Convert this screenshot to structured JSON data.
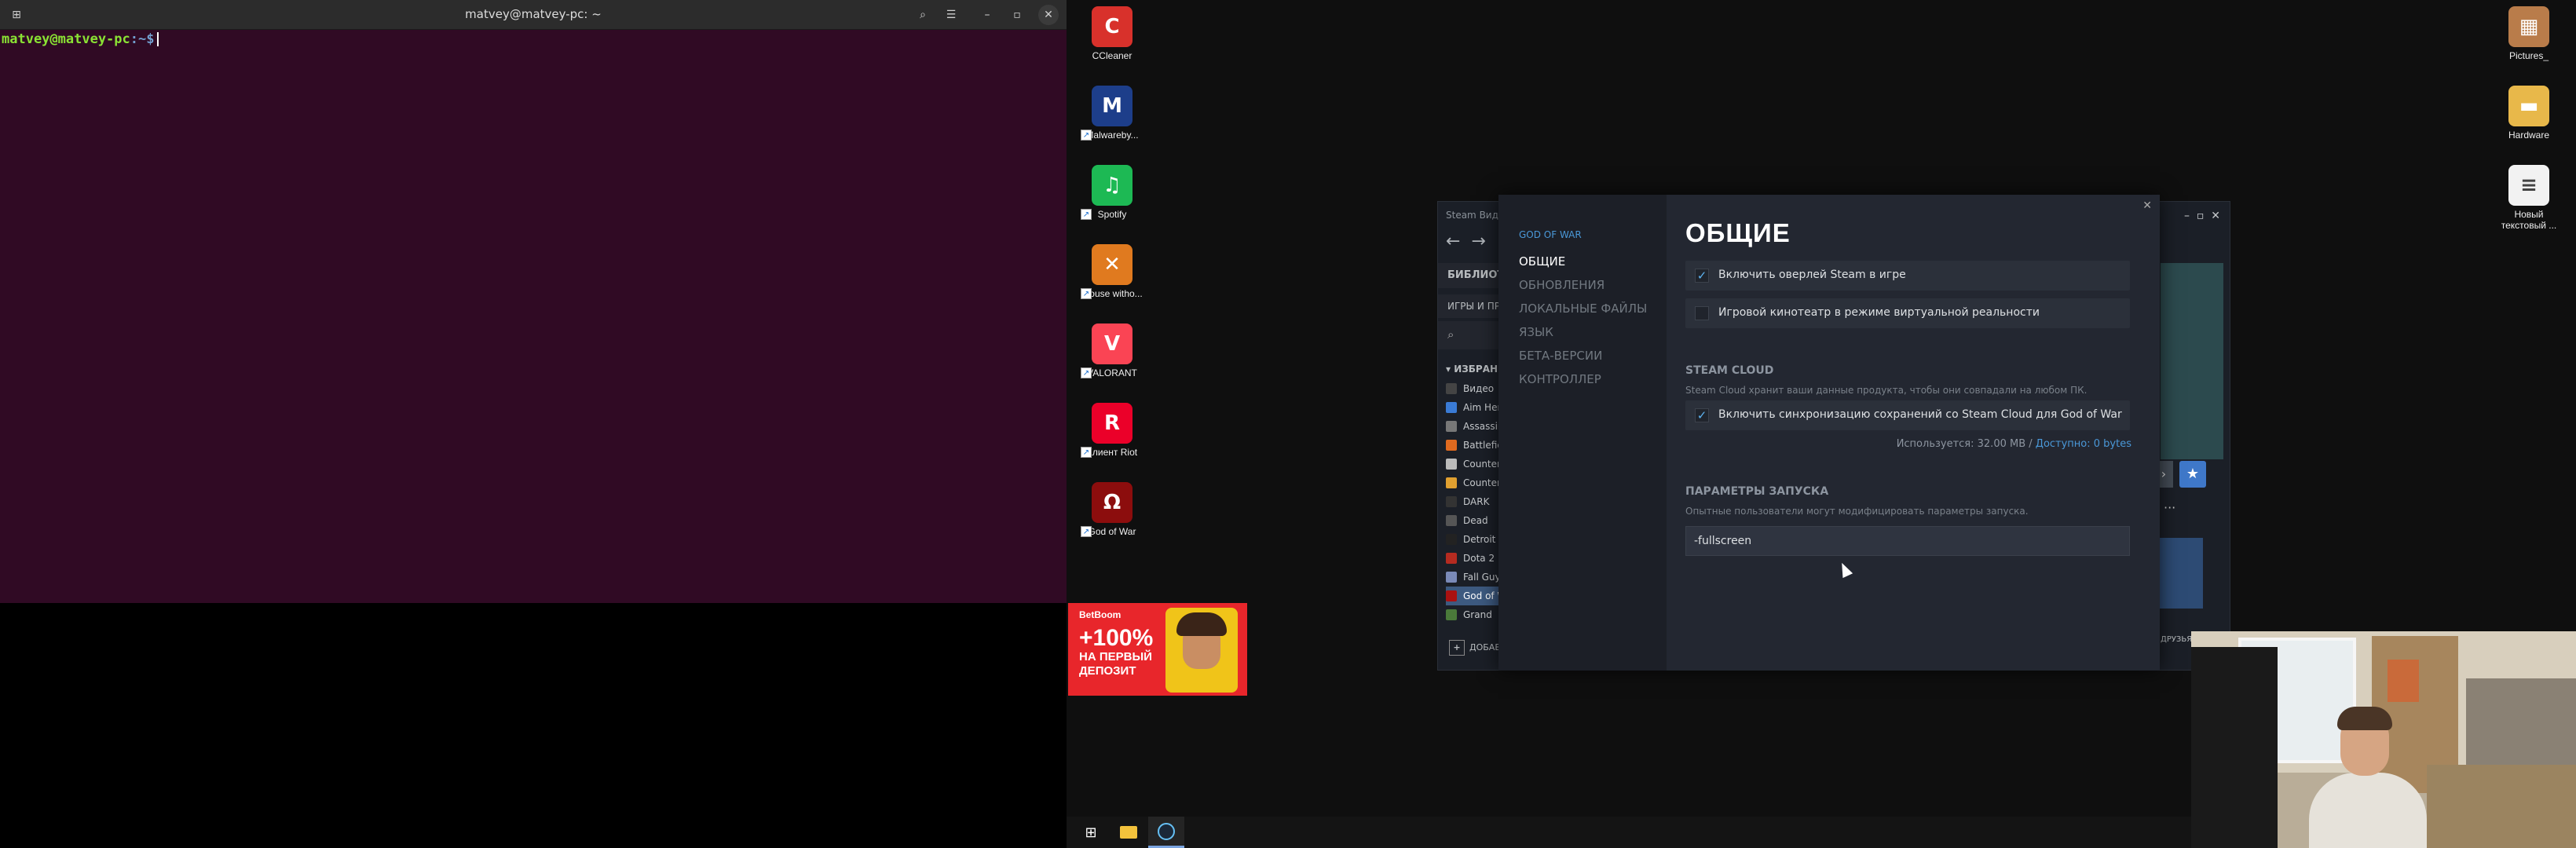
{
  "terminal": {
    "title": "matvey@matvey-pc: ~",
    "prompt_user": "matvey@matvey-pc",
    "prompt_path": ":~$",
    "buttons": {
      "search": "⌕",
      "menu": "☰",
      "min": "–",
      "max": "▫",
      "close": "✕"
    }
  },
  "desktop": {
    "left_icons": [
      {
        "label": "CCleaner",
        "color": "#d8312b",
        "glyph": "C"
      },
      {
        "label": "Malwareby...",
        "color": "#1d3e8a",
        "glyph": "M"
      },
      {
        "label": "Spotify",
        "color": "#1db954",
        "glyph": "♫"
      },
      {
        "label": "Mouse witho...",
        "color": "#e07a1f",
        "glyph": "✕"
      },
      {
        "label": "VALORANT",
        "color": "#fa4454",
        "glyph": "V"
      },
      {
        "label": "Клиент Riot",
        "color": "#eb0029",
        "glyph": "R"
      },
      {
        "label": "God of War",
        "color": "#8c0d0d",
        "glyph": "Ω"
      }
    ],
    "right_icons": [
      {
        "label": "Pictures_",
        "color": "#b97c4a",
        "glyph": "▦"
      },
      {
        "label": "Hardware",
        "color": "#e8b84a",
        "glyph": "▬"
      },
      {
        "label": "Новый текстовый ...",
        "color": "#f2f2f2",
        "glyph": "≡"
      }
    ]
  },
  "ad": {
    "brand": "BetBoom",
    "big": "+100%",
    "line1": "НА ПЕРВЫЙ",
    "line2": "ДЕПОЗИТ"
  },
  "steam_main": {
    "menu": "Steam   Вид",
    "library": "БИБЛИОТЕКА",
    "games": "ИГРЫ И ПРОГРАММЫ",
    "favorites": "ИЗБРАННОЕ",
    "games_list": [
      {
        "name": "Видео",
        "color": "#444"
      },
      {
        "name": "Aim Hero",
        "color": "#3a7bd5"
      },
      {
        "name": "Assassin's",
        "color": "#777"
      },
      {
        "name": "Battlefield",
        "color": "#e06a1f"
      },
      {
        "name": "Counter",
        "color": "#bbb"
      },
      {
        "name": "Counter",
        "color": "#e0a030"
      },
      {
        "name": "DARK",
        "color": "#333"
      },
      {
        "name": "Dead",
        "color": "#555"
      },
      {
        "name": "Detroit",
        "color": "#222"
      },
      {
        "name": "Dota 2",
        "color": "#b52b20"
      },
      {
        "name": "Fall Guys",
        "color": "#7a8ab8"
      },
      {
        "name": "God of War",
        "color": "#a11"
      },
      {
        "name": "Grand",
        "color": "#4a7a3a"
      }
    ],
    "add_game": "ДОБАВИТЬ ИГРУ",
    "chat": "ДРУЗЬЯ И ЧАТ",
    "more": "···",
    "star": "★"
  },
  "properties": {
    "game": "GOD OF WAR",
    "nav": [
      "ОБЩИЕ",
      "ОБНОВЛЕНИЯ",
      "ЛОКАЛЬНЫЕ ФАЙЛЫ",
      "ЯЗЫК",
      "БЕТА-ВЕРСИИ",
      "КОНТРОЛЛЕР"
    ],
    "heading": "ОБЩИЕ",
    "overlay_option": "Включить оверлей Steam в игре",
    "overlay_checked": true,
    "vr_option": "Игровой кинотеатр в режиме виртуальной реальности",
    "vr_checked": false,
    "cloud_title": "STEAM CLOUD",
    "cloud_desc": "Steam Cloud хранит ваши данные продукта, чтобы они совпадали на любом ПК.",
    "cloud_option": "Включить синхронизацию сохранений со Steam Cloud для God of War",
    "cloud_checked": true,
    "cloud_used": "Используется: 32.00 MB",
    "cloud_available": "Доступно: 0 bytes",
    "launch_title": "ПАРАМЕТРЫ ЗАПУСКА",
    "launch_desc": "Опытные пользователи могут модифицировать параметры запуска.",
    "launch_value": "-fullscreen"
  },
  "colors": {
    "steam_link": "#4a98d8",
    "terminal_bg": "#300a24",
    "ad_red": "#e8262b"
  }
}
